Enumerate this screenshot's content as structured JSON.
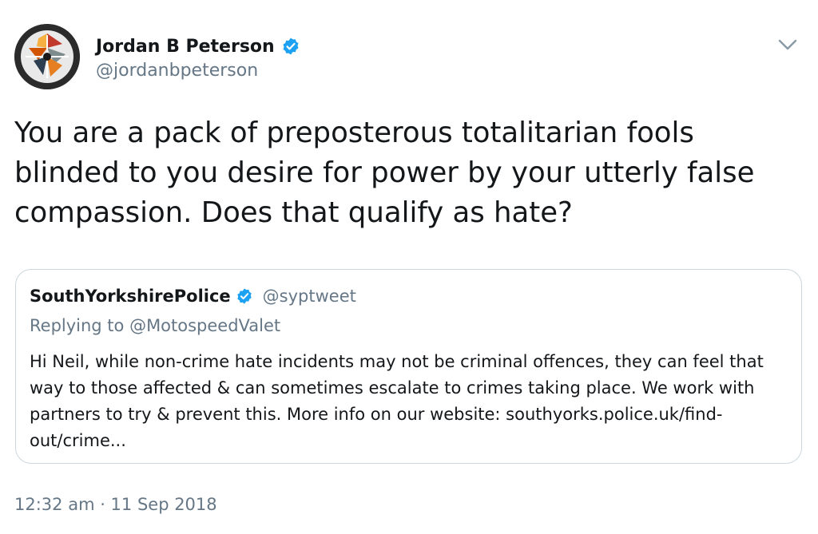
{
  "tweet": {
    "author": {
      "name": "Jordan B Peterson",
      "handle": "@jordanbpeterson",
      "verified": true,
      "avatar_icon": "avatar-logo"
    },
    "menu_icon": "chevron-down-icon",
    "text": "You are a pack of preposterous totalitarian fools blinded to you desire for power by your utterly false compassion. Does that qualify as hate?",
    "timestamp": "12:32 am · 11 Sep 2018"
  },
  "quoted_tweet": {
    "name": "SouthYorkshirePolice",
    "handle": "@syptweet",
    "verified": true,
    "replying_to": "Replying to @MotospeedValet",
    "text": "Hi Neil, while non-crime hate incidents may not be criminal offences, they can feel that way to those affected & can sometimes escalate to crimes taking place. We work with partners to try & prevent this. More info on our website: southyorks.police.uk/find-out/crime..."
  },
  "colors": {
    "text_primary": "#14171a",
    "text_secondary": "#657786",
    "verified_blue": "#1da1f2",
    "border": "#ccd6dd"
  }
}
